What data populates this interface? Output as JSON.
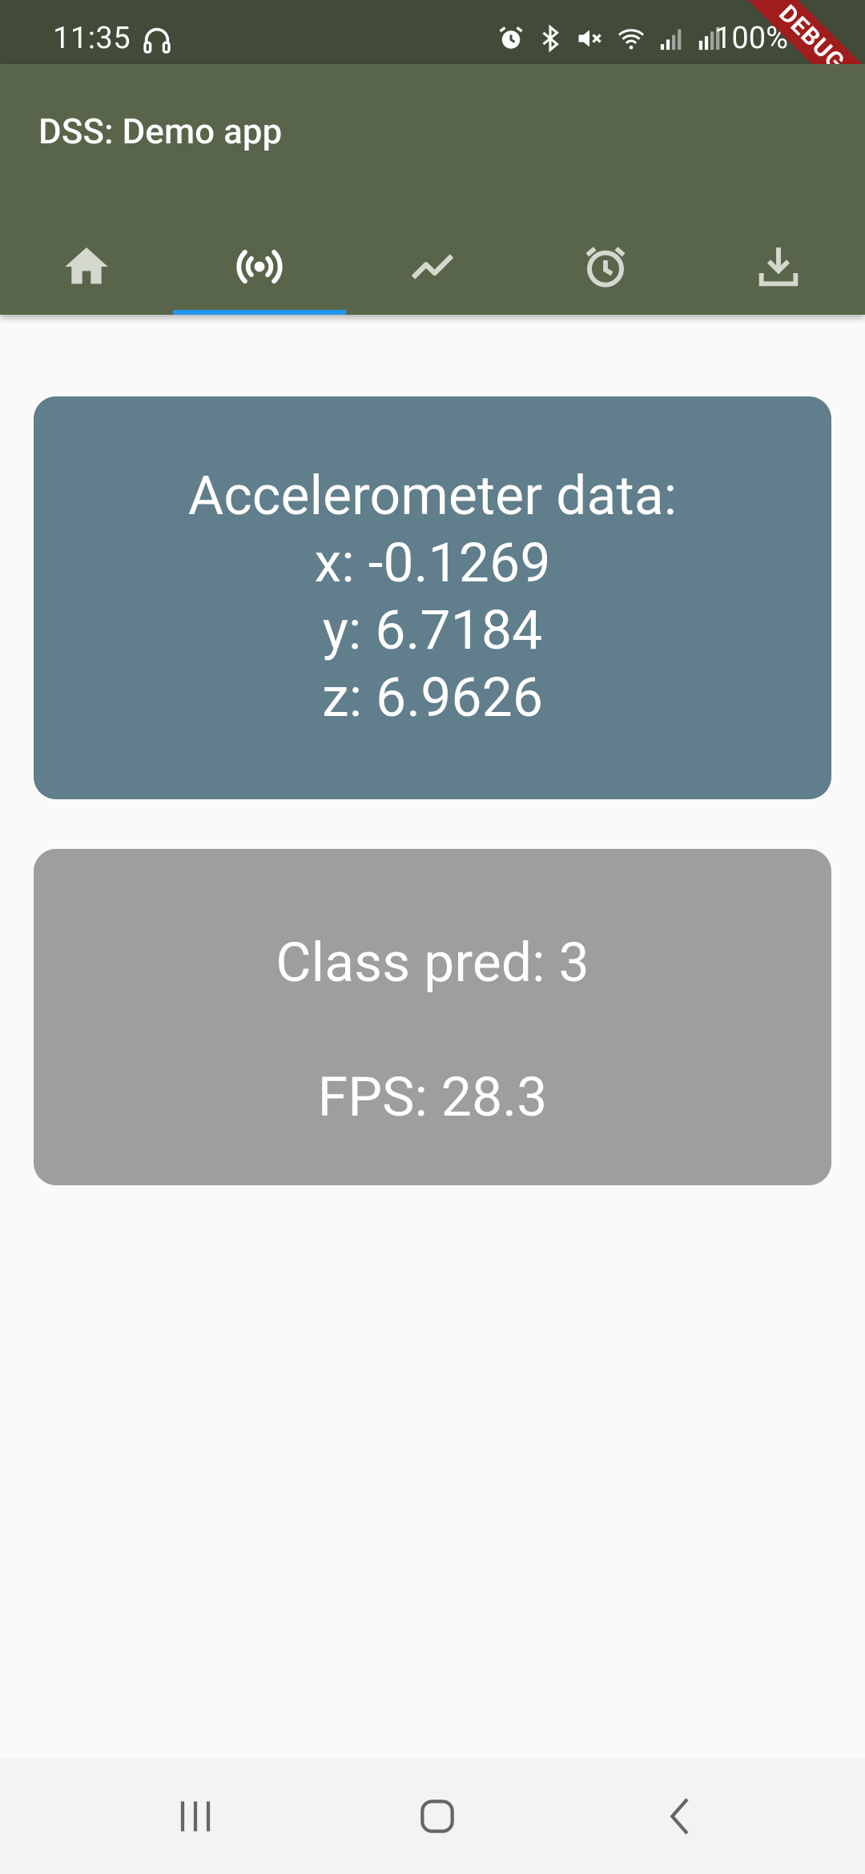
{
  "status_bar": {
    "time": "11:35",
    "battery_text": "100%",
    "icons": [
      "headphones-icon",
      "alarm-icon",
      "bluetooth-icon",
      "mute-icon",
      "wifi-icon",
      "signal-icon",
      "signal-2-icon",
      "battery-icon"
    ]
  },
  "app_bar": {
    "title": "DSS: Demo app",
    "debug_label": "DEBUG",
    "tabs": [
      {
        "icon": "home-icon",
        "selected": false
      },
      {
        "icon": "sensors-icon",
        "selected": true
      },
      {
        "icon": "chart-line-icon",
        "selected": false
      },
      {
        "icon": "alarm-clock-icon",
        "selected": false
      },
      {
        "icon": "download-icon",
        "selected": false
      }
    ],
    "colors": {
      "app_bar": "#59654a",
      "status_bar": "#424b38",
      "indicator": "#2196f3"
    }
  },
  "accelerometer_card": {
    "heading": "Accelerometer data:",
    "x": "x: -0.1269",
    "y": "y: 6.7184",
    "z": "z: 6.9626",
    "color": "#607e8b"
  },
  "prediction_card": {
    "class_pred": "Class pred: 3",
    "fps": "FPS: 28.3",
    "color": "#9e9e9e"
  },
  "nav_bar": {
    "buttons": [
      "recent-apps-icon",
      "home-button-icon",
      "back-icon"
    ]
  }
}
